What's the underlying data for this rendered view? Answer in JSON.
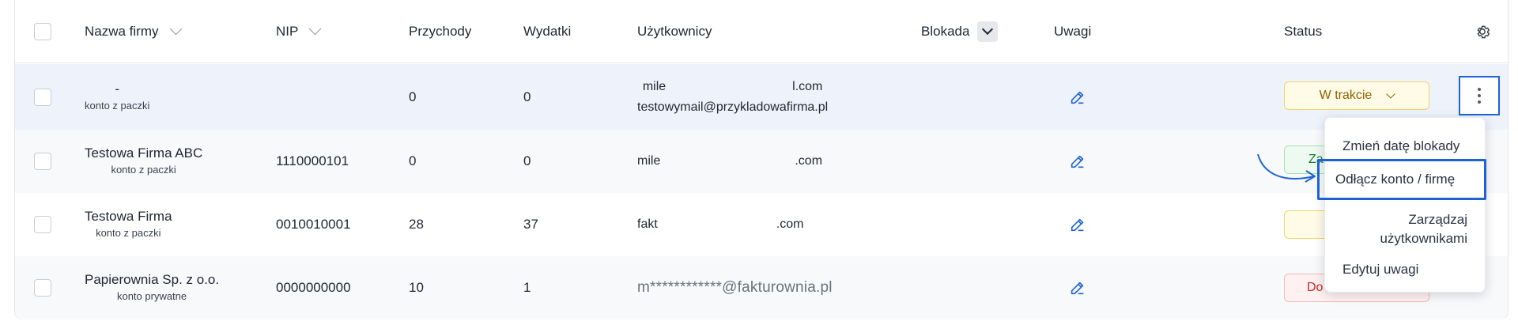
{
  "table": {
    "headers": {
      "company": "Nazwa firmy",
      "nip": "NIP",
      "revenue": "Przychody",
      "expenses": "Wydatki",
      "users": "Użytkownicy",
      "block": "Blokada",
      "notes": "Uwagi",
      "status": "Status"
    },
    "rows": [
      {
        "company_name": "-",
        "company_type": "konto z paczki",
        "nip": "",
        "revenue": "0",
        "expenses": "0",
        "user_line1_left": "mile",
        "user_line1_right": "l.com",
        "user_line2": "testowymail@przykladowafirma.pl",
        "status": "W trakcie"
      },
      {
        "company_name": "Testowa Firma ABC",
        "company_type": "konto z paczki",
        "nip": "1110000101",
        "revenue": "0",
        "expenses": "0",
        "user_line1_left": "mile",
        "user_line1_right": ".com",
        "status": "Za"
      },
      {
        "company_name": "Testowa Firma",
        "company_type": "konto z paczki",
        "nip": "0010010001",
        "revenue": "28",
        "expenses": "37",
        "user_line1_left": "fakt",
        "user_line1_right": ".com",
        "status": ""
      },
      {
        "company_name": "Papierownia Sp. z o.o.",
        "company_type": "konto prywatne",
        "nip": "0000000000",
        "revenue": "10",
        "expenses": "1",
        "user_masked": "m************@fakturownia.pl",
        "status": "Do"
      }
    ]
  },
  "context_menu": {
    "items": [
      "Zmień datę blokady",
      "Odłącz konto / firmę",
      "Zarządzaj\nużytkownikami",
      "Edytuj uwagi"
    ]
  },
  "icons": {
    "settings": "gear-icon",
    "edit": "edit-icon",
    "more": "kebab-icon",
    "pointer": "curved-arrow-icon"
  },
  "colors": {
    "accent": "#1d63d6",
    "status_yellow": "#f2d36b",
    "status_green": "#a7e0b3",
    "status_red": "#f2b8b8"
  }
}
